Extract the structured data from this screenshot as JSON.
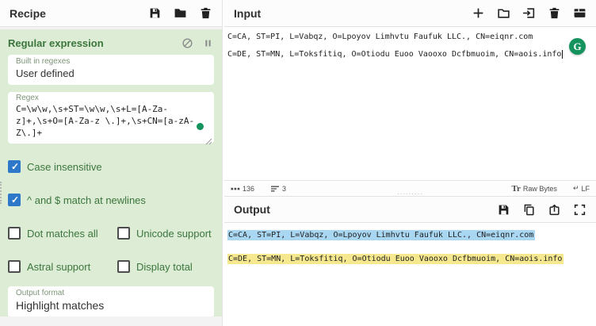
{
  "colors": {
    "op_background": "#dcecd5",
    "op_text": "#3c763d",
    "checkbox_checked": "#2d78c8",
    "highlight_blue": "#a9d7f2",
    "highlight_yellow": "#f6e88f",
    "grammarly_green": "#15935f"
  },
  "recipe": {
    "title": "Recipe",
    "operation": {
      "name": "Regular expression",
      "built_in_regexes": {
        "label": "Built in regexes",
        "value": "User defined"
      },
      "regex": {
        "label": "Regex",
        "value": "C=\\w\\w,\\s+ST=\\w\\w,\\s+L=[A-Za-z]+,\\s+O=[A-Za-z \\.]+,\\s+CN=[a-zA-Z\\.]+"
      },
      "checkboxes": [
        {
          "label": "Case insensitive",
          "checked": true
        },
        {
          "label": "^ and $ match at newlines",
          "checked": true
        },
        {
          "label": "Dot matches all",
          "checked": false
        },
        {
          "label": "Unicode support",
          "checked": false
        },
        {
          "label": "Astral support",
          "checked": false
        },
        {
          "label": "Display total",
          "checked": false
        }
      ],
      "output_format": {
        "label": "Output format",
        "value": "Highlight matches"
      }
    }
  },
  "input": {
    "title": "Input",
    "lines": [
      "C=CA, ST=PI, L=Vabqz, O=Lpoyov Limhvtu Faufuk LLC., CN=eiqnr.com",
      "",
      "C=DE, ST=MN, L=Toksfitiq, O=Otiodu Euoo Vaooxo Dcfbmuoim, CN=aois.info"
    ],
    "status": {
      "char_count": "136",
      "line_count": "3",
      "tr_label": "Tr",
      "encoding": "Raw Bytes",
      "line_ending_glyph": "↵",
      "line_ending": "LF"
    },
    "grammarly_label": "G"
  },
  "output": {
    "title": "Output",
    "lines": [
      {
        "text": "C=CA, ST=PI, L=Vabqz, O=Lpoyov Limhvtu Faufuk LLC., CN=eiqnr.com",
        "highlight": "#a9d7f2"
      },
      {
        "text": "",
        "highlight": ""
      },
      {
        "text": "C=DE, ST=MN, L=Toksfitiq, O=Otiodu Euoo Vaooxo Dcfbmuoim, CN=aois.info",
        "highlight": "#f6e88f"
      }
    ]
  }
}
